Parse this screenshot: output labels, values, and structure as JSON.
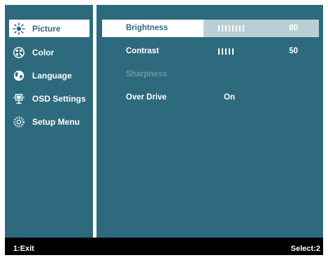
{
  "sidebar": {
    "items": [
      {
        "label": "Picture",
        "icon": "sun-icon"
      },
      {
        "label": "Color",
        "icon": "palette-icon"
      },
      {
        "label": "Language",
        "icon": "globe-icon"
      },
      {
        "label": "OSD Settings",
        "icon": "osd-icon"
      },
      {
        "label": "Setup Menu",
        "icon": "gear-icon"
      }
    ],
    "selected": "Picture"
  },
  "settings": {
    "brightness": {
      "label": "Brightness",
      "value": "80",
      "level": 80
    },
    "contrast": {
      "label": "Contrast",
      "value": "50",
      "level": 50
    },
    "sharpness": {
      "label": "Sharpness",
      "enabled": false
    },
    "overdrive": {
      "label": "Over Drive",
      "value": "On"
    }
  },
  "footer": {
    "left": "1:Exit",
    "right": "Select:2"
  },
  "colors": {
    "panel": "#2e6a7d",
    "highlight": "#ffffff",
    "value_box": "#b9cfd6",
    "disabled_text": "#6f96a3",
    "footer_bg": "#000000"
  }
}
